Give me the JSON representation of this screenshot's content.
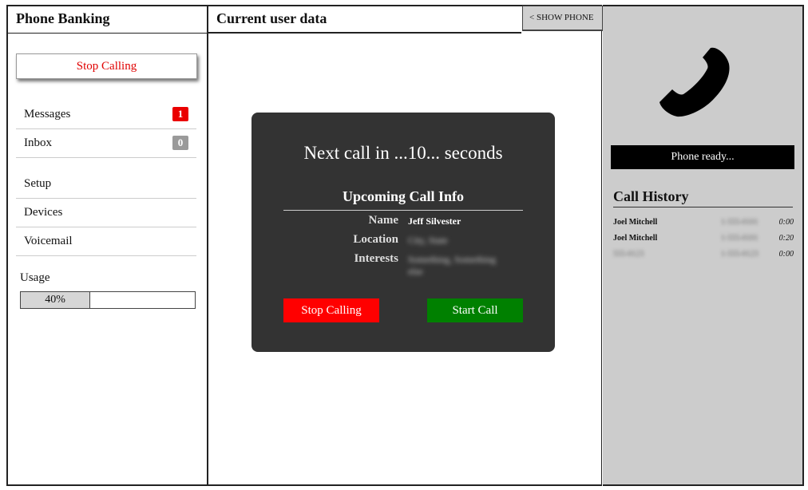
{
  "sidebar": {
    "title": "Phone Banking",
    "stop_button": "Stop Calling",
    "nav_top": [
      {
        "label": "Messages",
        "badge": "1",
        "badge_color": "#ea0000"
      },
      {
        "label": "Inbox",
        "badge": "0",
        "badge_color": "#9a9a9a"
      }
    ],
    "nav_bottom": [
      {
        "label": "Setup"
      },
      {
        "label": "Devices"
      },
      {
        "label": "Voicemail"
      }
    ],
    "usage": {
      "label": "Usage",
      "percent_text": "40%",
      "value": 0.4
    }
  },
  "main": {
    "title": "Current user data",
    "show_phone_tab": "< SHOW PHONE"
  },
  "modal": {
    "countdown": "Next call in ...10... seconds",
    "upcoming_title": "Upcoming Call Info",
    "fields": {
      "name_label": "Name",
      "name_value": "Jeff Silvester",
      "location_label": "Location",
      "location_value": "City, State",
      "interests_label": "Interests",
      "interests_value": "Something, Something else"
    },
    "stop_button": "Stop Calling",
    "start_button": "Start Call",
    "stop_color": "#ff0000",
    "start_color": "#008000"
  },
  "phone": {
    "status": "Phone ready...",
    "history_title": "Call History",
    "history": [
      {
        "name": "Joel Mitchell",
        "number": "1-555-0101",
        "duration": "0:00"
      },
      {
        "name": "Joel Mitchell",
        "number": "1-555-0101",
        "duration": "0:20"
      },
      {
        "name": "555-0123",
        "number": "1-555-0123",
        "duration": "0:00"
      }
    ]
  }
}
